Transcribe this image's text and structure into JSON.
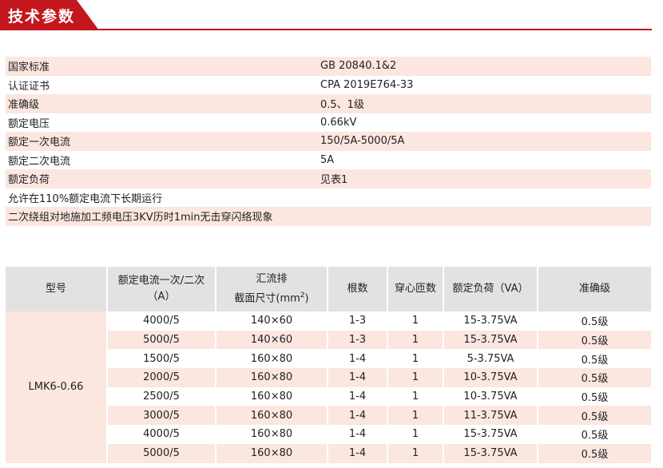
{
  "header": {
    "title": "技术参数",
    "accent_color": "#c3161d"
  },
  "specs": [
    {
      "label": "国家标准",
      "value": "GB 20840.1&2"
    },
    {
      "label": "认证证书",
      "value": "CPA 2019E764-33"
    },
    {
      "label": "准确级",
      "value": "0.5、1级"
    },
    {
      "label": "额定电压",
      "value": "0.66kV"
    },
    {
      "label": "额定一次电流",
      "value": "150/5A-5000/5A"
    },
    {
      "label": "额定二次电流",
      "value": "5A"
    },
    {
      "label": "额定负荷",
      "value": "见表1"
    }
  ],
  "notes": [
    "允许在110%额定电流下长期运行",
    "二次绕组对地施加工频电压3KV历时1min无击穿闪络现象"
  ],
  "table": {
    "headers": {
      "model": "型号",
      "current_line1": "额定电流一次/二次",
      "current_line2": "（A）",
      "busbar_line1": "汇流排",
      "busbar_line2": "截面尺寸(mm",
      "busbar_sup": "2",
      "busbar_end": ")",
      "count": "根数",
      "turns": "穿心匝数",
      "load": "额定负荷（VA）",
      "accuracy": "准确级"
    },
    "model": "LMK6-0.66",
    "rows": [
      {
        "current": "4000/5",
        "busbar": "140×60",
        "count": "1-3",
        "turns": "1",
        "load": "15-3.75VA",
        "accuracy": "0.5级"
      },
      {
        "current": "5000/5",
        "busbar": "140×60",
        "count": "1-3",
        "turns": "1",
        "load": "15-3.75VA",
        "accuracy": "0.5级"
      },
      {
        "current": "1500/5",
        "busbar": "160×80",
        "count": "1-4",
        "turns": "1",
        "load": "5-3.75VA",
        "accuracy": "0.5级"
      },
      {
        "current": "2000/5",
        "busbar": "160×80",
        "count": "1-4",
        "turns": "1",
        "load": "10-3.75VA",
        "accuracy": "0.5级"
      },
      {
        "current": "2500/5",
        "busbar": "160×80",
        "count": "1-4",
        "turns": "1",
        "load": "10-3.75VA",
        "accuracy": "0.5级"
      },
      {
        "current": "3000/5",
        "busbar": "160×80",
        "count": "1-4",
        "turns": "1",
        "load": "11-3.75VA",
        "accuracy": "0.5级"
      },
      {
        "current": "4000/5",
        "busbar": "160×80",
        "count": "1-4",
        "turns": "1",
        "load": "15-3.75VA",
        "accuracy": "0.5级"
      },
      {
        "current": "5000/5",
        "busbar": "160×80",
        "count": "1-4",
        "turns": "1",
        "load": "15-3.75VA",
        "accuracy": "0.5级"
      }
    ]
  }
}
